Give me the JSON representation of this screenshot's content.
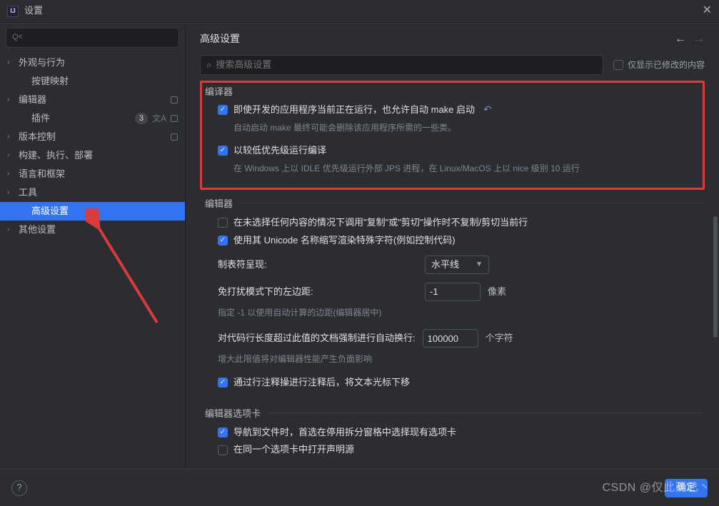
{
  "title": "设置",
  "close_glyph": "✕",
  "sidebar": {
    "search_placeholder": "",
    "search_icon": "Q˂",
    "items": [
      {
        "label": "外观与行为",
        "expandable": true,
        "depth": 0
      },
      {
        "label": "按键映射",
        "expandable": false,
        "depth": 1
      },
      {
        "label": "编辑器",
        "expandable": true,
        "depth": 0,
        "cfg": true
      },
      {
        "label": "插件",
        "expandable": false,
        "depth": 1,
        "badge": "3",
        "lang": true,
        "cfg": true
      },
      {
        "label": "版本控制",
        "expandable": true,
        "depth": 0,
        "cfg": true
      },
      {
        "label": "构建、执行、部署",
        "expandable": true,
        "depth": 0
      },
      {
        "label": "语言和框架",
        "expandable": true,
        "depth": 0
      },
      {
        "label": "工具",
        "expandable": true,
        "depth": 0
      },
      {
        "label": "高级设置",
        "expandable": false,
        "depth": 1,
        "selected": true
      },
      {
        "label": "其他设置",
        "expandable": true,
        "depth": 0
      }
    ]
  },
  "header": {
    "title": "高级设置",
    "back": "←",
    "forward": "→"
  },
  "toolbar": {
    "search_placeholder": "搜索高级设置",
    "only_modified": "仅显示已修改的内容"
  },
  "section_compiler": {
    "title": "编译器",
    "opt1_label": "即使开发的应用程序当前正在运行，也允许自动 make 启动",
    "opt1_desc": "自动启动 make 最终可能会删除该应用程序所需的一些类。",
    "opt2_label": "以较低优先级运行编译",
    "opt2_desc": "在 Windows 上以 IDLE 优先级运行外部 JPS 进程，在 Linux/MacOS 上以 nice 级别 10 运行"
  },
  "section_editor": {
    "title": "编辑器",
    "copy_cut_label": "在未选择任何内容的情况下调用\"复制\"或\"剪切\"操作时不复制/剪切当前行",
    "unicode_label": "使用其 Unicode 名称缩写渲染特殊字符(例如控制代码)",
    "tab_render_label": "制表符呈现:",
    "tab_render_value": "水平线",
    "zen_margin_label": "免打扰模式下的左边距:",
    "zen_margin_value": "-1",
    "pixel_unit": "像素",
    "zen_margin_desc": "指定 -1 以使用自动计算的边距(编辑器居中)",
    "wrap_label": "对代码行长度超过此值的文档强制进行自动换行:",
    "wrap_value": "100000",
    "chars_unit": "个字符",
    "wrap_desc": "增大此限值将对编辑器性能产生负面影响",
    "comment_label": "通过行注释操进行注释后，将文本光标下移"
  },
  "section_tabs": {
    "title": "编辑器选项卡",
    "nav_label": "导航到文件时，首选在停用拆分窗格中选择现有选项卡",
    "decl_label": "在同一个选项卡中打开声明源"
  },
  "footer": {
    "ok": "确定"
  },
  "watermark": "CSDN @仅此而已丶"
}
